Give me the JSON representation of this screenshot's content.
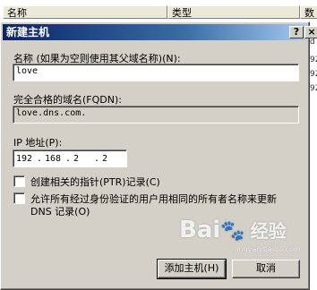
{
  "background_list": {
    "columns": [
      "名称",
      "类型",
      "数"
    ],
    "fragments": [
      "c",
      "d",
      "92",
      "92",
      "92"
    ]
  },
  "dialog": {
    "title": "新建主机",
    "help_button": "?",
    "close_button": "×",
    "name_label": "名称 (如果为空则使用其父域名称)(N):",
    "name_value": "love",
    "fqdn_label": "完全合格的域名(FQDN):",
    "fqdn_value": "love.dns.com.",
    "ip_label": "IP 地址(P):",
    "ip_octets": [
      "192",
      "168",
      "2",
      "2"
    ],
    "ip_separator": ".",
    "ptr_checkbox_label": "创建相关的指针(PTR)记录(C)",
    "ptr_checked": false,
    "allow_checkbox_label_line1": "允许所有经过身份验证的用户用相同的所有者名称来更新",
    "allow_checkbox_label_line2": "DNS 记录(O)",
    "allow_checked": false,
    "add_host_button": "添加主机(H)",
    "cancel_button": "取消"
  },
  "watermark": {
    "brand": "Bai",
    "paw": "🐾",
    "cn": "经验",
    "sub": "jingyan.baidu.com"
  }
}
